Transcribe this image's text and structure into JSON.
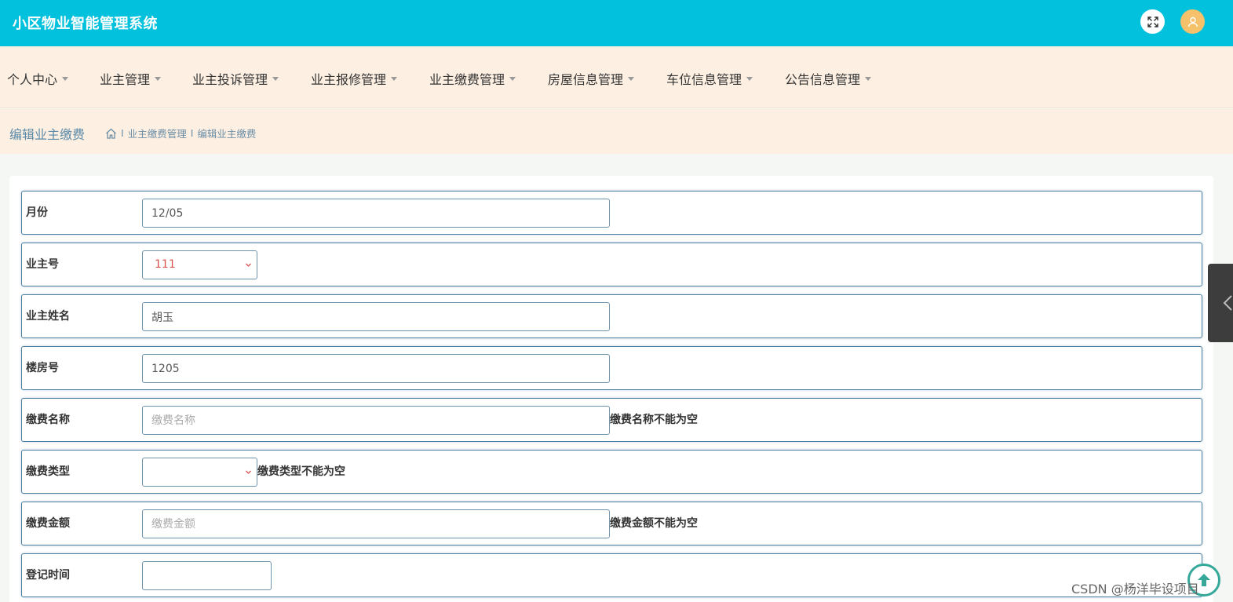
{
  "header": {
    "app_title": "小区物业智能管理系统"
  },
  "nav": {
    "items": [
      {
        "label": "个人中心"
      },
      {
        "label": "业主管理"
      },
      {
        "label": "业主投诉管理"
      },
      {
        "label": "业主报修管理"
      },
      {
        "label": "业主缴费管理"
      },
      {
        "label": "房屋信息管理"
      },
      {
        "label": "车位信息管理"
      },
      {
        "label": "公告信息管理"
      }
    ]
  },
  "breadcrumb": {
    "page_title": "编辑业主缴费",
    "separator": "I",
    "items": [
      "业主缴费管理",
      "编辑业主缴费"
    ]
  },
  "form": {
    "month": {
      "label": "月份",
      "value": "12/05"
    },
    "owner_no": {
      "label": "业主号",
      "value": "111"
    },
    "owner_name": {
      "label": "业主姓名",
      "value": "胡玉"
    },
    "building_no": {
      "label": "楼房号",
      "value": "1205"
    },
    "fee_name": {
      "label": "缴费名称",
      "value": "",
      "placeholder": "缴费名称",
      "error": "缴费名称不能为空"
    },
    "fee_type": {
      "label": "缴费类型",
      "value": "",
      "error": "缴费类型不能为空"
    },
    "fee_amount": {
      "label": "缴费金额",
      "value": "",
      "placeholder": "缴费金额",
      "error": "缴费金额不能为空"
    },
    "register_time": {
      "label": "登记时间",
      "value": ""
    }
  },
  "watermark": "CSDN @杨洋毕设项目",
  "colors": {
    "header_bg": "#02c1dd",
    "nav_bg": "#fdf0e3",
    "row_border": "#4a7ea0",
    "select_value": "#d9534f"
  }
}
